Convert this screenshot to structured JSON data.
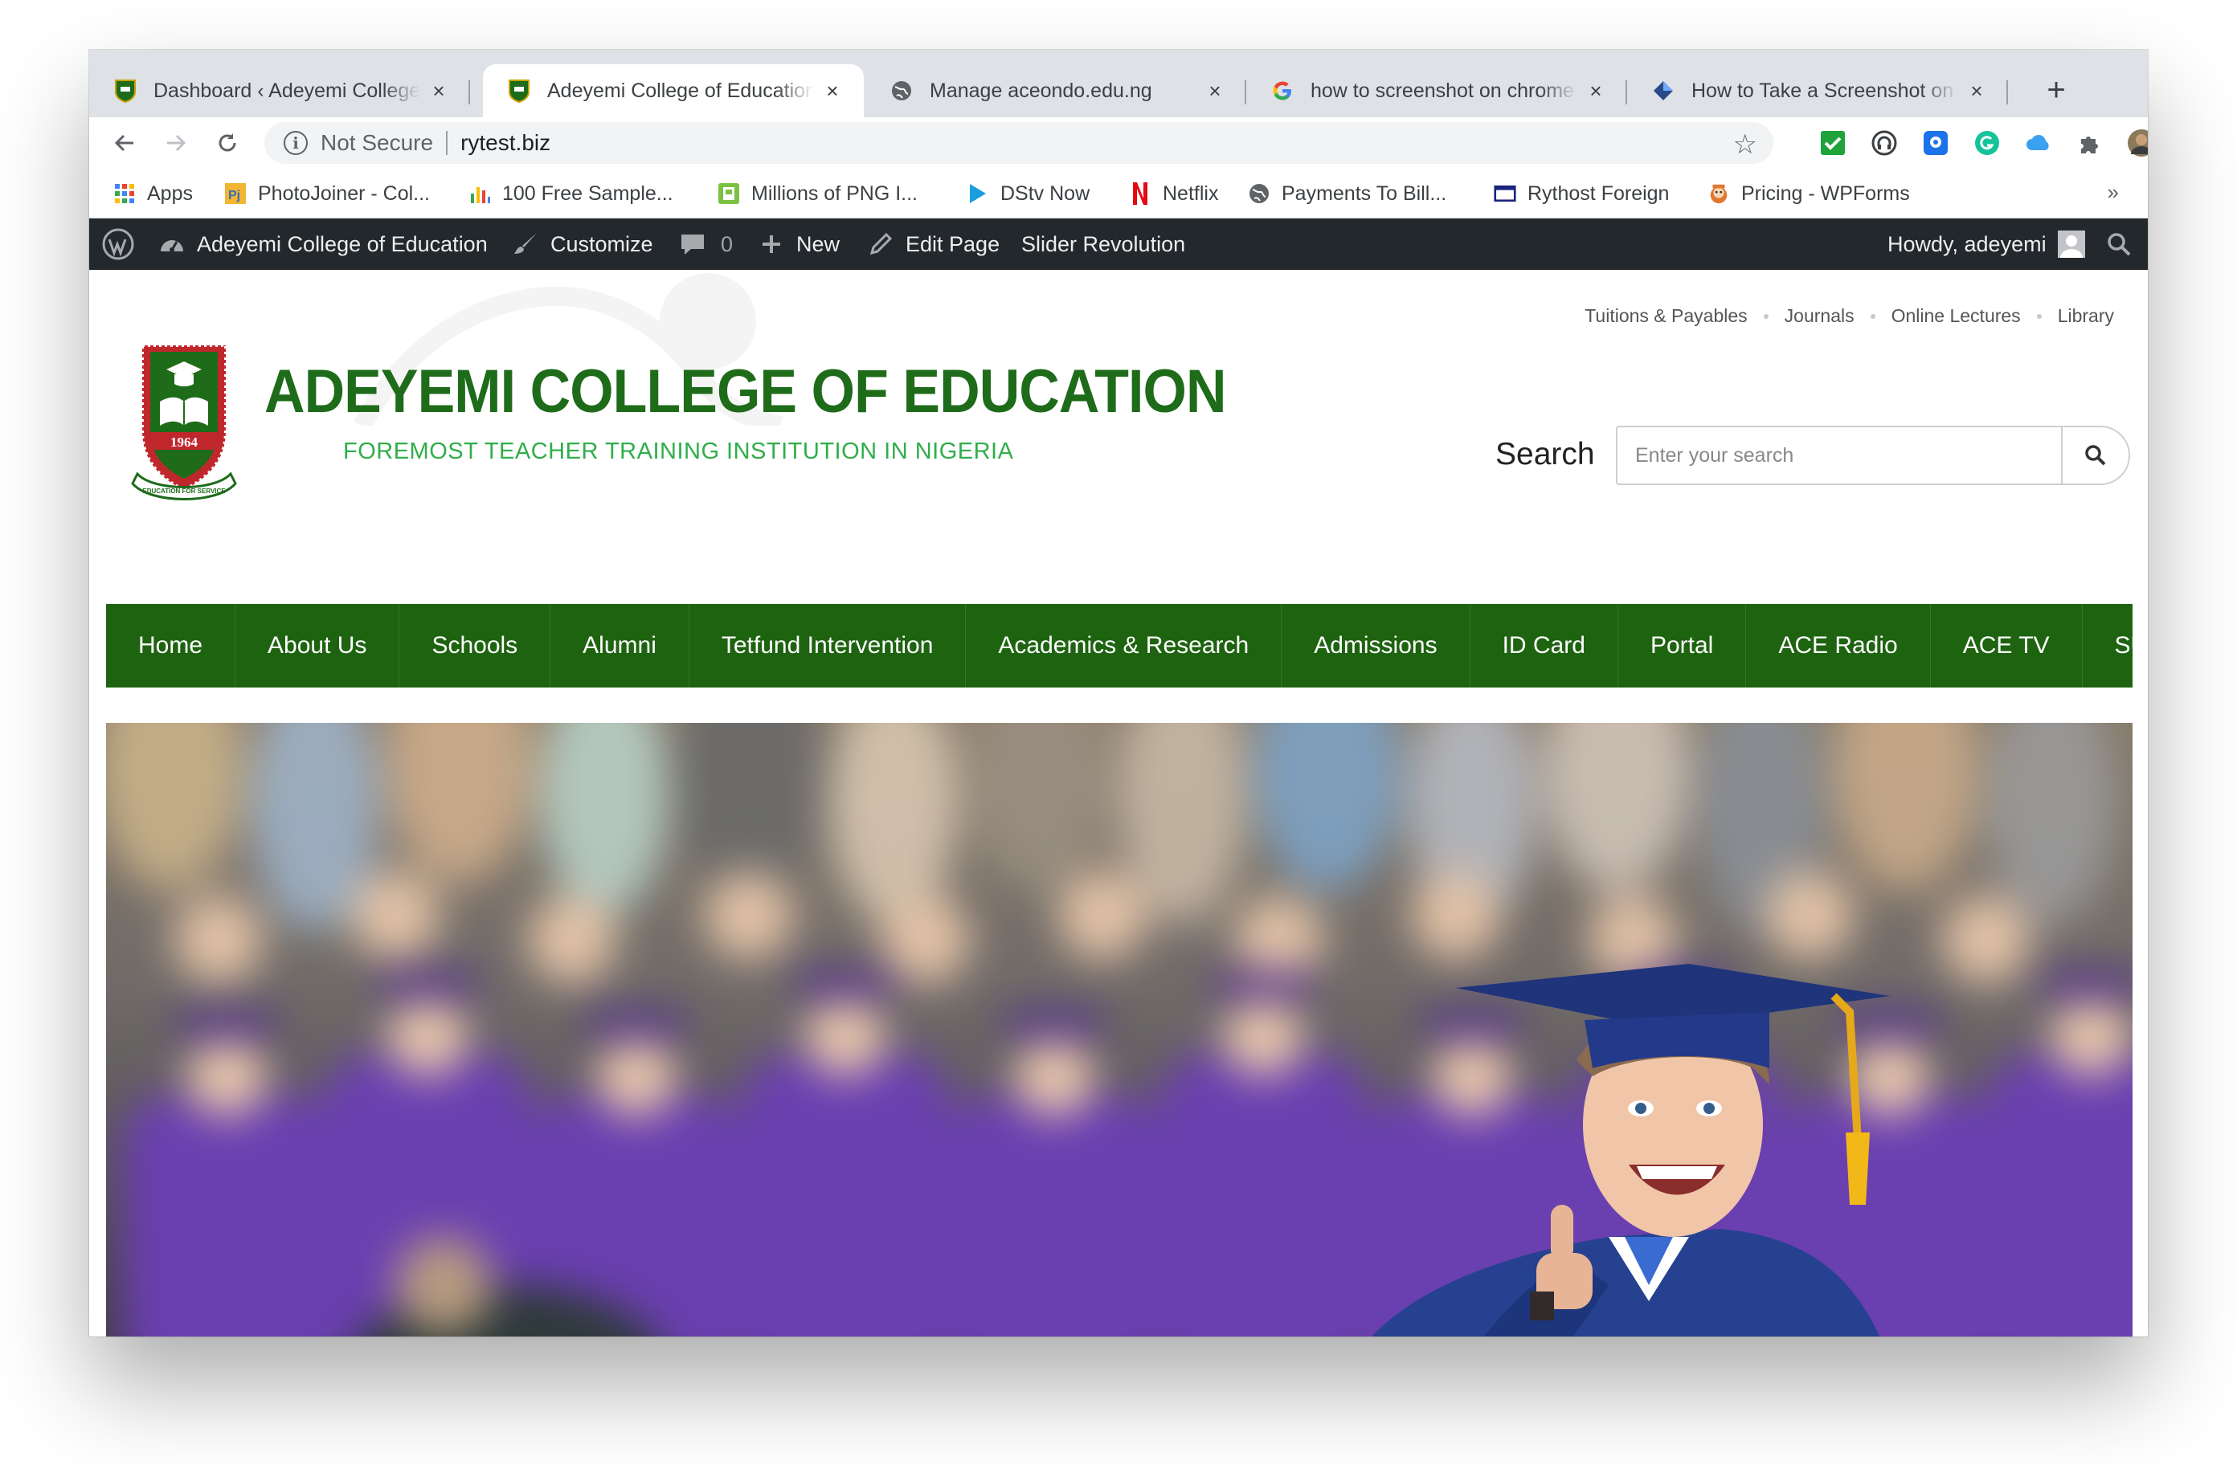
{
  "browser": {
    "tabs": [
      {
        "title": "Dashboard ‹ Adeyemi College",
        "icon": "college-crest-icon",
        "active": false
      },
      {
        "title": "Adeyemi College of Education",
        "icon": "college-crest-icon",
        "active": true
      },
      {
        "title": "Manage aceondo.edu.ng",
        "icon": "globe-icon",
        "active": false
      },
      {
        "title": "how to screenshot on chrome",
        "icon": "google-icon",
        "active": false
      },
      {
        "title": "How to Take a Screenshot on",
        "icon": "diamond-logo-icon",
        "active": false
      }
    ],
    "close_glyph": "×",
    "new_tab_glyph": "+",
    "address": {
      "security_label": "Not Secure",
      "url": "rytest.biz"
    },
    "bookmarks": [
      {
        "label": "Apps",
        "icon": "apps-grid-icon"
      },
      {
        "label": "PhotoJoiner - Col...",
        "icon": "photojoiner-icon"
      },
      {
        "label": "100 Free Sample...",
        "icon": "sample-icon"
      },
      {
        "label": "Millions of PNG I...",
        "icon": "png-icon"
      },
      {
        "label": "DStv Now",
        "icon": "dstv-icon"
      },
      {
        "label": "Netflix",
        "icon": "netflix-icon"
      },
      {
        "label": "Payments To Bill...",
        "icon": "globe-icon"
      },
      {
        "label": "Rythost Foreign",
        "icon": "window-icon"
      },
      {
        "label": "Pricing - WPForms",
        "icon": "wpforms-icon"
      }
    ],
    "bookmarks_overflow": "»"
  },
  "admin_bar": {
    "site_name": "Adeyemi College of Education",
    "customize": "Customize",
    "comments_count": "0",
    "new": "New",
    "edit_page": "Edit Page",
    "slider": "Slider Revolution",
    "howdy": "Howdy, adeyemi"
  },
  "site": {
    "top_links": [
      "Tuitions & Payables",
      "Journals",
      "Online Lectures",
      "Library"
    ],
    "title": "ADEYEMI COLLEGE OF EDUCATION",
    "tagline": "FOREMOST TEACHER TRAINING INSTITUTION IN NIGERIA",
    "emblem_year": "1964",
    "emblem_motto": "EDUCATION FOR SERVICE",
    "search_label": "Search",
    "search_placeholder": "Enter your search",
    "nav": [
      "Home",
      "About Us",
      "Schools",
      "Alumni",
      "Tetfund Intervention",
      "Academics & Research",
      "Admissions",
      "ID Card",
      "Portal",
      "ACE Radio",
      "ACE TV",
      "SUG"
    ]
  },
  "colors": {
    "brand_green": "#1e6310",
    "title_green": "#1e6b1a",
    "tagline_green": "#2fae4a",
    "admin_bar": "#23282d",
    "gown_purple": "#6a3fb0"
  }
}
